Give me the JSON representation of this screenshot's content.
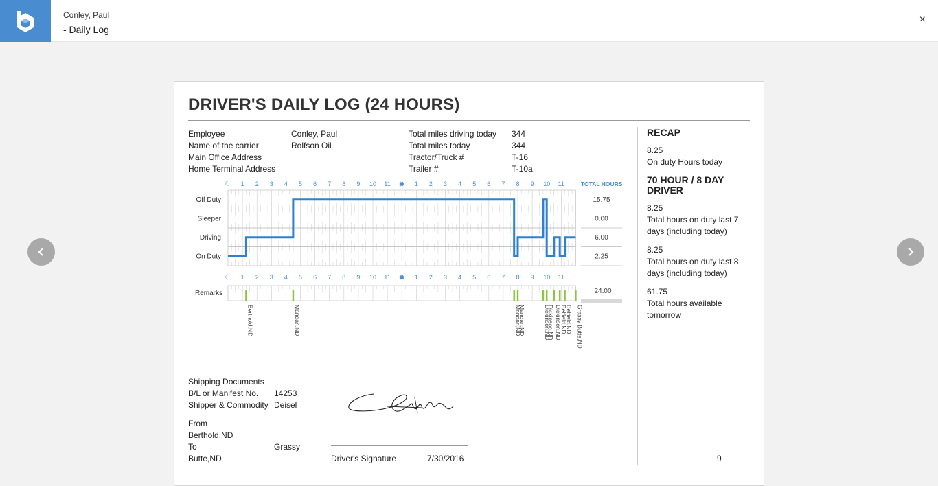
{
  "header": {
    "name": "Conley, Paul",
    "title": "- Daily Log",
    "close": "×"
  },
  "nav": {
    "prev": "‹",
    "next": "›"
  },
  "log": {
    "title": "DRIVER'S DAILY LOG (24 HOURS)",
    "left_labels": [
      "Employee",
      "Name of the carrier",
      "Main Office Address",
      "Home Terminal Address"
    ],
    "left_values": [
      "Conley, Paul",
      "Rolfson Oil",
      "",
      ""
    ],
    "right_labels": [
      "Total miles driving today",
      "Total miles today",
      "Tractor/Truck #",
      "Trailer #"
    ],
    "right_values": [
      "344",
      "344",
      "T-16",
      "T-10a"
    ]
  },
  "grid": {
    "total_hours_label": "TOTAL HOURS",
    "hour_labels": [
      "1",
      "2",
      "3",
      "4",
      "5",
      "6",
      "7",
      "8",
      "9",
      "10",
      "11",
      "1",
      "2",
      "3",
      "4",
      "5",
      "6",
      "7",
      "8",
      "9",
      "10",
      "11"
    ],
    "rows": [
      {
        "label": "Off Duty",
        "total": "15.75"
      },
      {
        "label": "Sleeper",
        "total": "0.00"
      },
      {
        "label": "Driving",
        "total": "6.00"
      },
      {
        "label": "On Duty",
        "total": "2.25"
      }
    ],
    "grand_total": "24.00",
    "remarks_label": "Remarks",
    "duty_line": [
      [
        0,
        3
      ],
      [
        1.25,
        3
      ],
      [
        1.25,
        2
      ],
      [
        4.5,
        2
      ],
      [
        4.5,
        0
      ],
      [
        19.75,
        0
      ],
      [
        19.75,
        3
      ],
      [
        20,
        3
      ],
      [
        20,
        2
      ],
      [
        21.75,
        2
      ],
      [
        21.75,
        0
      ],
      [
        22,
        0
      ],
      [
        22,
        3
      ],
      [
        22.5,
        3
      ],
      [
        22.5,
        2
      ],
      [
        22.9,
        2
      ],
      [
        22.9,
        3
      ],
      [
        23.25,
        3
      ],
      [
        23.25,
        2
      ],
      [
        24,
        2
      ]
    ],
    "remarks": [
      {
        "hour": 1.25,
        "location": "Berthold,ND"
      },
      {
        "hour": 4.5,
        "location": "Mandan,ND"
      },
      {
        "hour": 19.75,
        "location": "Mandan,ND"
      },
      {
        "hour": 20,
        "location": "Mandan,ND"
      },
      {
        "hour": 21.75,
        "location": "Dickinson,ND"
      },
      {
        "hour": 22,
        "location": "Dickinson,ND"
      },
      {
        "hour": 22.5,
        "location": "Dickinson,ND"
      },
      {
        "hour": 22.9,
        "location": "Belfield,ND"
      },
      {
        "hour": 23.25,
        "location": "Belfield,ND"
      },
      {
        "hour": 24,
        "location": "Grassy Butte,ND"
      }
    ]
  },
  "recap": {
    "title": "RECAP",
    "on_duty_value": "8.25",
    "on_duty_label": "On duty Hours today",
    "driver_type": "70 HOUR / 8 DAY DRIVER",
    "items": [
      {
        "value": "8.25",
        "label": "Total hours on duty last 7 days (including today)"
      },
      {
        "value": "8.25",
        "label": "Total hours on duty last 8 days (including today)"
      },
      {
        "value": "61.75",
        "label": "Total hours available tomorrow"
      }
    ]
  },
  "shipping": {
    "heading": "Shipping Documents",
    "bl_label": "B/L or Manifest No.",
    "bl_value": "14253",
    "shipper_label": "Shipper & Commodity",
    "shipper_value": "Deisel",
    "from_label": "From",
    "from_value": "Berthold,ND",
    "to_label": "To",
    "to_value_1": "Grassy",
    "to_value_2": "Butte,ND"
  },
  "signature": {
    "label": "Driver's Signature",
    "date": "7/30/2016",
    "page": "9"
  },
  "colors": {
    "accent": "#4a8cd0",
    "duty_line": "#2f80d1",
    "remark_mark": "#8cc63f",
    "hour_label": "#4a90d9"
  }
}
